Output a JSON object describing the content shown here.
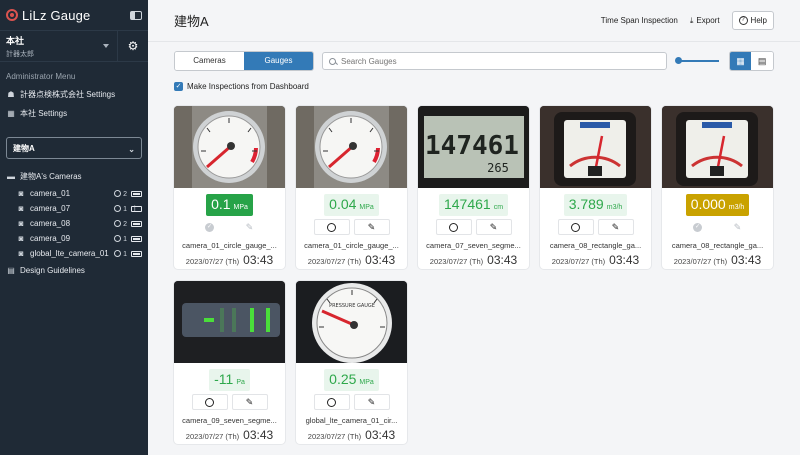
{
  "app": {
    "name": "LiLz Gauge"
  },
  "account": {
    "name": "本社",
    "user": "計器太郎"
  },
  "sidebar": {
    "admin_label": "Administrator Menu",
    "links": [
      {
        "label": "計器点検株式会社 Settings",
        "icon": "org-chart-icon"
      },
      {
        "label": "本社 Settings",
        "icon": "building-icon"
      }
    ],
    "building_select": "建物A",
    "cameras_heading": "建物A's Cameras",
    "cameras": [
      {
        "name": "camera_01",
        "count": "2",
        "battery": "full"
      },
      {
        "name": "camera_07",
        "count": "1",
        "battery": "low"
      },
      {
        "name": "camera_08",
        "count": "2",
        "battery": "full"
      },
      {
        "name": "camera_09",
        "count": "1",
        "battery": "full"
      },
      {
        "name": "global_lte_camera_01",
        "count": "1",
        "battery": "full"
      }
    ],
    "design_guidelines": "Design Guidelines"
  },
  "header": {
    "title": "建物A",
    "time_span": "Time Span Inspection",
    "export": "Export",
    "help": "Help"
  },
  "toolbar": {
    "tab_cameras": "Cameras",
    "tab_gauges": "Gauges",
    "active_tab": "Gauges",
    "search_placeholder": "Search Gauges",
    "view_mode": "grid"
  },
  "dashboard_check": {
    "label": "Make Inspections from Dashboard",
    "checked": true
  },
  "colors": {
    "accent": "#337ab7",
    "ok": "#2ea84b",
    "warn": "#c9a200",
    "sidebar": "#1f2a36"
  },
  "cards": [
    {
      "name": "camera_01_circle_gauge_...",
      "value": "0.1",
      "unit": "MPa",
      "style": "ok-strong",
      "inspected": true,
      "date": "2023/07/27 (Th)",
      "time": "03:43",
      "thumb": "round-gauge"
    },
    {
      "name": "camera_01_circle_gauge_...",
      "value": "0.04",
      "unit": "MPa",
      "style": "ok",
      "inspected": false,
      "date": "2023/07/27 (Th)",
      "time": "03:43",
      "thumb": "round-gauge"
    },
    {
      "name": "camera_07_seven_segme...",
      "value": "147461",
      "unit": "cm",
      "style": "ok",
      "inspected": false,
      "date": "2023/07/27 (Th)",
      "time": "03:43",
      "thumb": "lcd",
      "lcd_main": "147461",
      "lcd_sub": "265"
    },
    {
      "name": "camera_08_rectangle_ga...",
      "value": "3.789",
      "unit": "m3/h",
      "style": "ok",
      "inspected": false,
      "date": "2023/07/27 (Th)",
      "time": "03:43",
      "thumb": "rect-gauge"
    },
    {
      "name": "camera_08_rectangle_ga...",
      "value": "0.000",
      "unit": "m3/h",
      "style": "warn",
      "inspected": true,
      "date": "2023/07/27 (Th)",
      "time": "03:43",
      "thumb": "rect-gauge"
    },
    {
      "name": "camera_09_seven_segme...",
      "value": "-11",
      "unit": "Pa",
      "style": "ok",
      "inspected": false,
      "date": "2023/07/27 (Th)",
      "time": "03:43",
      "thumb": "led"
    },
    {
      "name": "global_lte_camera_01_cir...",
      "value": "0.25",
      "unit": "MPa",
      "style": "ok",
      "inspected": false,
      "date": "2023/07/27 (Th)",
      "time": "03:43",
      "thumb": "pressure-gauge"
    }
  ]
}
